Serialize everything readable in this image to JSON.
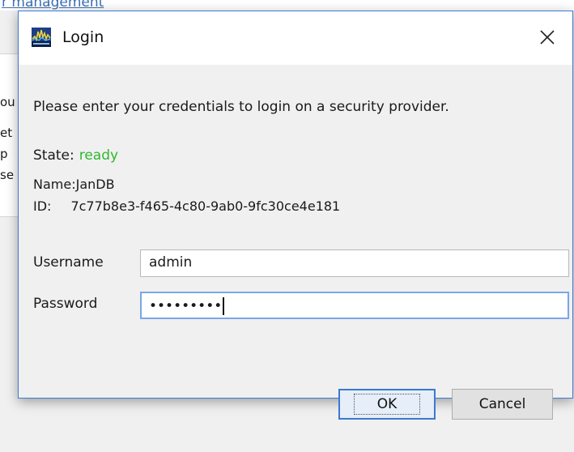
{
  "background": {
    "title_fragment": "r management",
    "side_fragments": [
      "ou",
      "et",
      "p",
      "se"
    ]
  },
  "dialog": {
    "title": "Login",
    "app_icon": "signal-wave-icon",
    "close_glyph": "✕",
    "instruction": "Please enter your credentials to login on a security provider.",
    "state_label": "State:",
    "state_value": "ready",
    "name_label": "Name:",
    "name_value": "JanDB",
    "id_label": "ID:",
    "id_value": "7c77b8e3-f465-4c80-9ab0-9fc30ce4e181",
    "username_label": "Username",
    "username_value": "admin",
    "password_label": "Password",
    "password_mask": "•••••••••",
    "ok_label": "OK",
    "cancel_label": "Cancel"
  },
  "colors": {
    "state_ready": "#2fb82f",
    "accent_border": "#3d7bd1",
    "link": "#3c6fb6"
  }
}
